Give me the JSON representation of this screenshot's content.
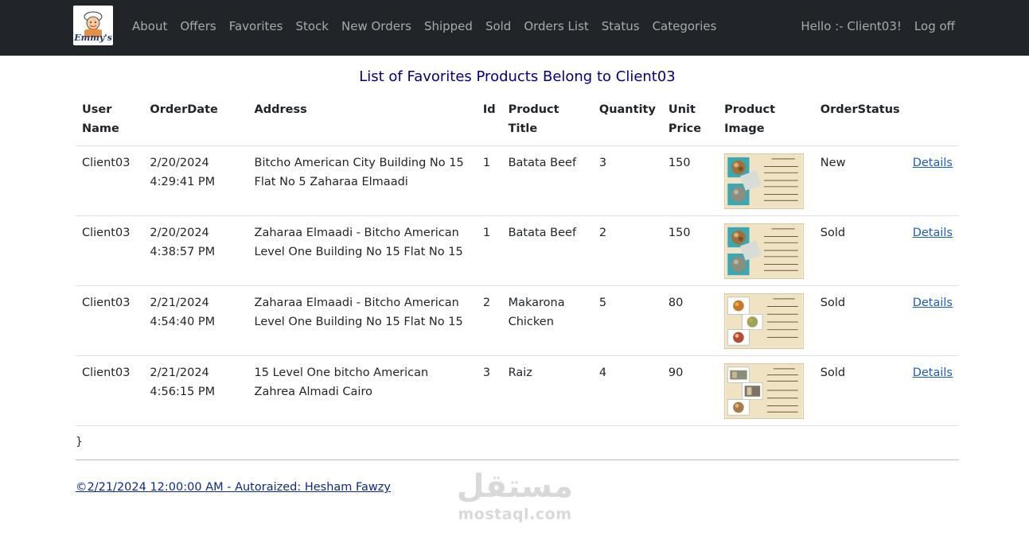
{
  "nav": {
    "brand_logo_text": "Emmy's",
    "links": [
      "About",
      "Offers",
      "Favorites",
      "Stock",
      "New Orders",
      "Shipped",
      "Sold",
      "Orders List",
      "Status",
      "Categories"
    ],
    "greeting": "Hello :- Client03!",
    "logoff": "Log off"
  },
  "page": {
    "title": "List of Favorites Products Belong to Client03"
  },
  "table": {
    "headers": {
      "user": [
        "User",
        "Name"
      ],
      "orderdate": "OrderDate",
      "address": "Address",
      "id": "Id",
      "title": "Product Title",
      "quantity": "Quantity",
      "price": [
        "Unit",
        "Price"
      ],
      "image": [
        "Product",
        "Image"
      ],
      "status": "OrderStatus"
    },
    "rows": [
      {
        "user": "Client03",
        "date": "2/20/2024",
        "time": "4:29:41 PM",
        "address": "Bitcho American City Building No 15 Flat No 5 Zaharaa Elmaadi",
        "id": "1",
        "title": "Batata Beef",
        "quantity": "3",
        "price": "150",
        "status": "New",
        "details": "Details"
      },
      {
        "user": "Client03",
        "date": "2/20/2024",
        "time": "4:38:57 PM",
        "address": "Zaharaa Elmaadi - Bitcho American Level One Building No 15 Flat No 15",
        "id": "1",
        "title": "Batata Beef",
        "quantity": "2",
        "price": "150",
        "status": "Sold",
        "details": "Details"
      },
      {
        "user": "Client03",
        "date": "2/21/2024",
        "time": "4:54:40 PM",
        "address": "Zaharaa Elmaadi - Bitcho American Level One Building No 15 Flat No 15",
        "id": "2",
        "title": "Makarona Chicken",
        "quantity": "5",
        "price": "80",
        "status": "Sold",
        "details": "Details"
      },
      {
        "user": "Client03",
        "date": "2/21/2024",
        "time": "4:56:15 PM",
        "address": "15 Level One bitcho American Zahrea Almadi Cairo",
        "id": "3",
        "title": "Raiz",
        "quantity": "4",
        "price": "90",
        "status": "Sold",
        "details": "Details"
      }
    ]
  },
  "stray_text": "}",
  "footer": {
    "text": "©2/21/2024 12:00:00 AM - Autoraized: Hesham Fawzy"
  },
  "watermark": {
    "arabic": "مستقل",
    "latin": "mostaql.com"
  },
  "colors": {
    "navbar_bg": "#212529",
    "title_color": "#000080",
    "link_color": "#1a5fb4",
    "menu_card_bg": "#efe3c4",
    "menu_card_teal": "#3aa7b5"
  }
}
